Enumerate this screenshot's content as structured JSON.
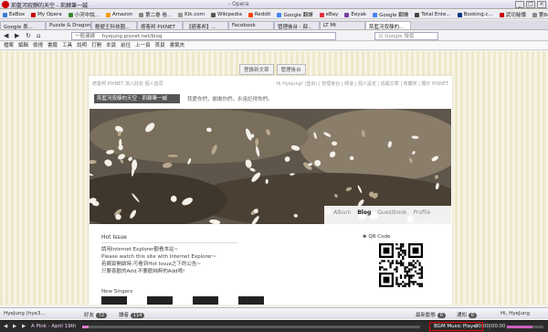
{
  "window": {
    "title": "荊藍河寂靜的天空 - 荊棘筆一誠",
    "center_title": "- Opera",
    "buttons": [
      "_",
      "□",
      "×"
    ]
  },
  "bookmarks": [
    {
      "label": "EeBox",
      "color": "#3a7bd5"
    },
    {
      "label": "My Opera",
      "color": "#c00"
    },
    {
      "label": "小河中說...",
      "color": "#3a8b2d"
    },
    {
      "label": "Amazon",
      "color": "#f39c12"
    },
    {
      "label": "第二巻 卷...",
      "color": "#888"
    },
    {
      "label": "Kik.com",
      "color": "#999"
    },
    {
      "label": "Wikipedia",
      "color": "#555"
    },
    {
      "label": "Reddit",
      "color": "#ff4500"
    },
    {
      "label": "Google 翻譯",
      "color": "#4285f4"
    },
    {
      "label": "eBay",
      "color": "#e53238"
    },
    {
      "label": "Eeyak",
      "color": "#7b3fa0"
    },
    {
      "label": "Google 翻譯",
      "color": "#4285f4"
    },
    {
      "label": "Total Ente...",
      "color": "#444"
    },
    {
      "label": "Booking.c...",
      "color": "#003580"
    },
    {
      "label": "武功秘傳",
      "color": "#c00"
    },
    {
      "label": "第84章 魚...",
      "color": "#888"
    },
    {
      "label": "Theoretica...",
      "color": "#555"
    },
    {
      "label": "Evolution...",
      "color": "#2a7"
    }
  ],
  "tabs": [
    {
      "label": "Google 表...",
      "active": false
    },
    {
      "label": "Puzzle & Dragon...",
      "active": false
    },
    {
      "label": "輕便王科技圈...",
      "active": false
    },
    {
      "label": "痞客邦 PIXNET",
      "active": false
    },
    {
      "label": "【痞客邦】...",
      "active": false
    },
    {
      "label": "Facebook",
      "active": false
    },
    {
      "label": "管理後台 - 部...",
      "active": false
    },
    {
      "label": "LT Mt",
      "active": false
    },
    {
      "label": "荊藍河寂靜的...",
      "active": true
    }
  ],
  "navbar": {
    "url_prefix": "一般連線",
    "url": "hyejung.pixnet.net/blog",
    "search_placeholder": "以 Google 搜尋"
  },
  "menubar": [
    "檔案",
    "編輯",
    "檢視",
    "書籤",
    "工具",
    "說明",
    "打開",
    "本頁",
    "前往",
    "上一頁",
    "首頁",
    "書籤夾"
  ],
  "blog": {
    "login_buttons": [
      "登錄新文章",
      "管理後台"
    ],
    "toplinks": "痞客邦 PIXNET   加入好友   個人首頁",
    "topright": "Hi Hyejung! (登出) | 管理後台 | 頻道 | 個人設定 | 追蹤文章 | 收藏夾 | 關於 PIXNET",
    "title": "荊藍河寂靜的天空 - 荊棘筆一誠",
    "description": "我愛你們，謝謝你們，永遠記得你們。",
    "nav": [
      "Album",
      "Blog",
      "Guestbook",
      "Profile"
    ],
    "nav_active": "Blog",
    "hot_title": "Hot Issue",
    "hot_lines": [
      "請用Internet Explorer觀看本站~",
      "Please watch this site with Internet Explorer~",
      "若網頁開啟時,可看到Hot Issue之下的公告~",
      "只要喜歡的Add,不要歡純粹的Add唷!"
    ],
    "new_singers": "New Singers",
    "qr_label": "QR Code"
  },
  "taskbar": {
    "user_left": "HyeJung (hye3...",
    "friends_label": "好友",
    "friends_count": "72",
    "readers_label": "讀者",
    "readers_count": "114",
    "latest_label": "最新動態",
    "latest_count": "0",
    "notify_label": "通知",
    "notify_count": "0",
    "greeting": "Hi, HyeJung"
  },
  "player": {
    "track": "A Pink - April 19th",
    "bgm_label": "BGM Music Player",
    "time": "00:00|00:00",
    "progress": 0.02,
    "volume": 0.7
  }
}
